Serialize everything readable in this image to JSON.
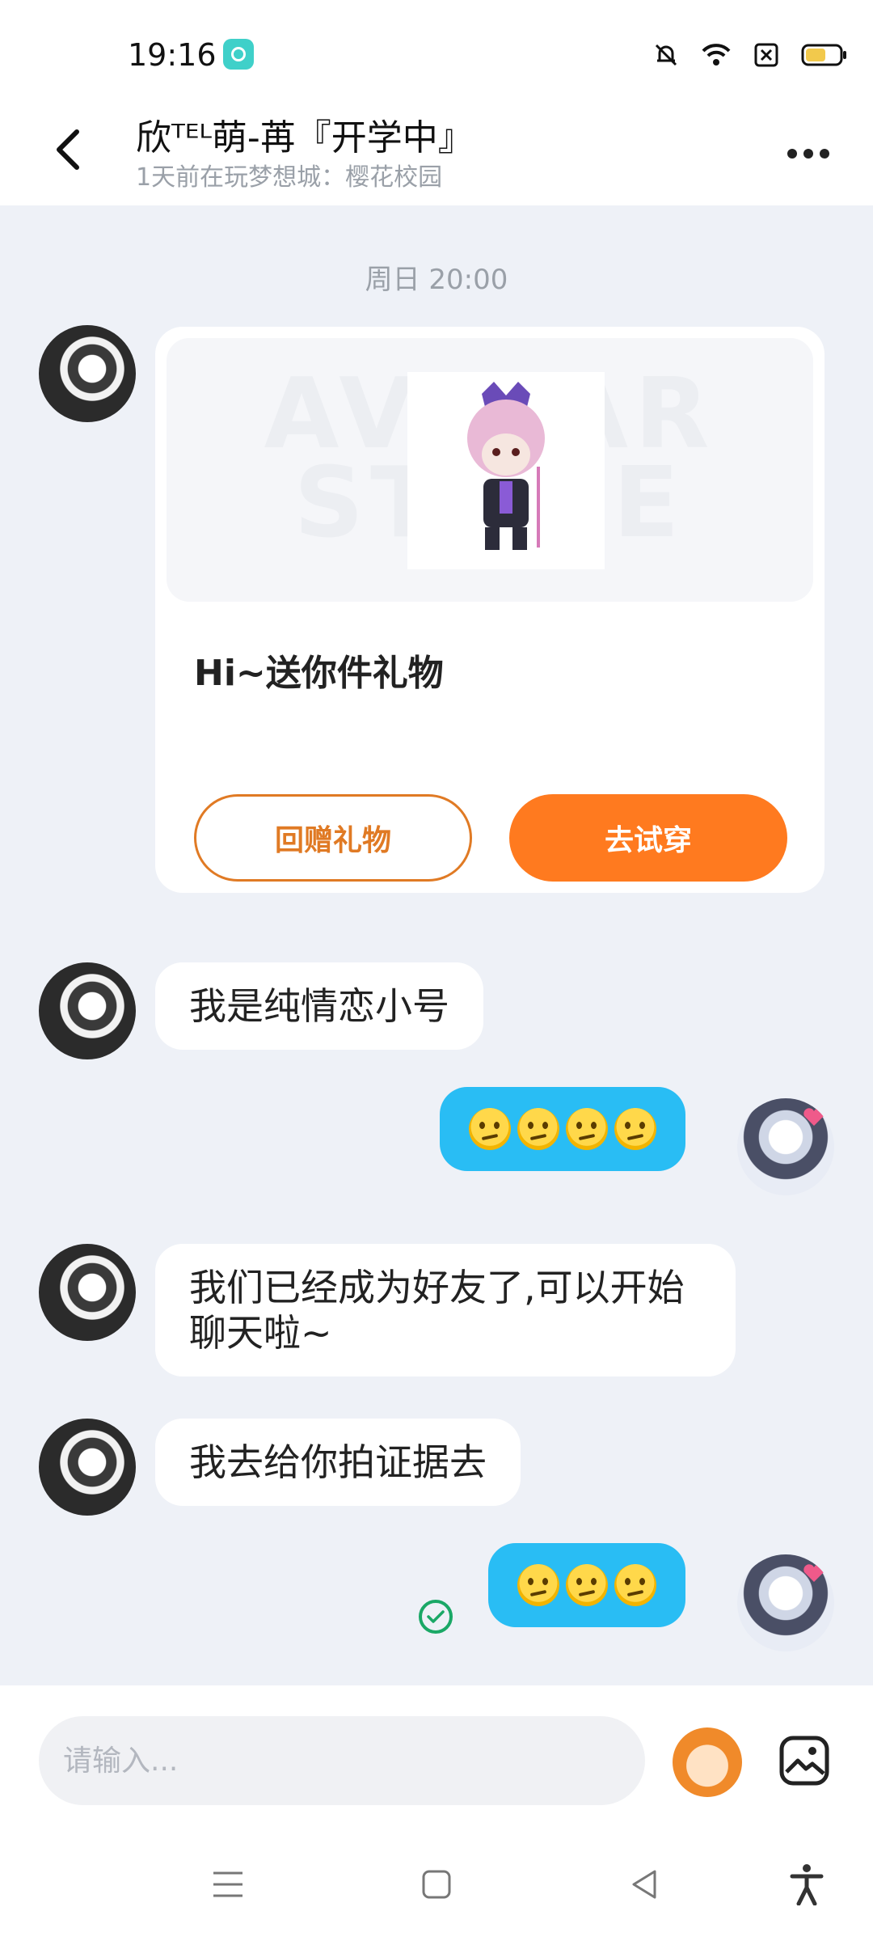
{
  "status_bar": {
    "time": "19:16",
    "icons": [
      "chat-app-icon",
      "bell-muted-icon",
      "wifi-icon",
      "no-sim-icon",
      "battery-icon"
    ]
  },
  "header": {
    "title": "欣ᵀᴱᴸ萌-苒『开学中』",
    "subtitle": "1天前在玩梦想城：樱花校园",
    "icons": [
      "back-arrow-icon",
      "more-icon"
    ]
  },
  "chat": {
    "timestamp": "周日 20:00",
    "gift_card": {
      "watermark": "AVATAR STORE",
      "title": "Hi~送你件礼物",
      "return_gift_label": "回赠礼物",
      "try_on_label": "去试穿"
    },
    "messages": [
      {
        "side": "left",
        "text": "我是纯情恋小号"
      },
      {
        "side": "right",
        "emoji": "thinking-face",
        "count": 4
      },
      {
        "side": "left",
        "text": "我们已经成为好友了,可以开始\n聊天啦~"
      },
      {
        "side": "left",
        "text": "我去给你拍证据去"
      },
      {
        "side": "right",
        "emoji": "thinking-face",
        "count": 3,
        "status": "read-check-icon"
      }
    ]
  },
  "input_bar": {
    "placeholder": "请输入...",
    "icons": [
      "mascot-icon",
      "gallery-icon"
    ]
  },
  "nav_bar": {
    "icons": [
      "menu-icon",
      "home-square-icon",
      "back-triangle-icon",
      "accessibility-icon"
    ]
  },
  "colors": {
    "accent_orange": "#ff7a1f",
    "bubble_blue": "#29bdf4",
    "background": "#eef1f7",
    "read_green": "#1aa866"
  }
}
